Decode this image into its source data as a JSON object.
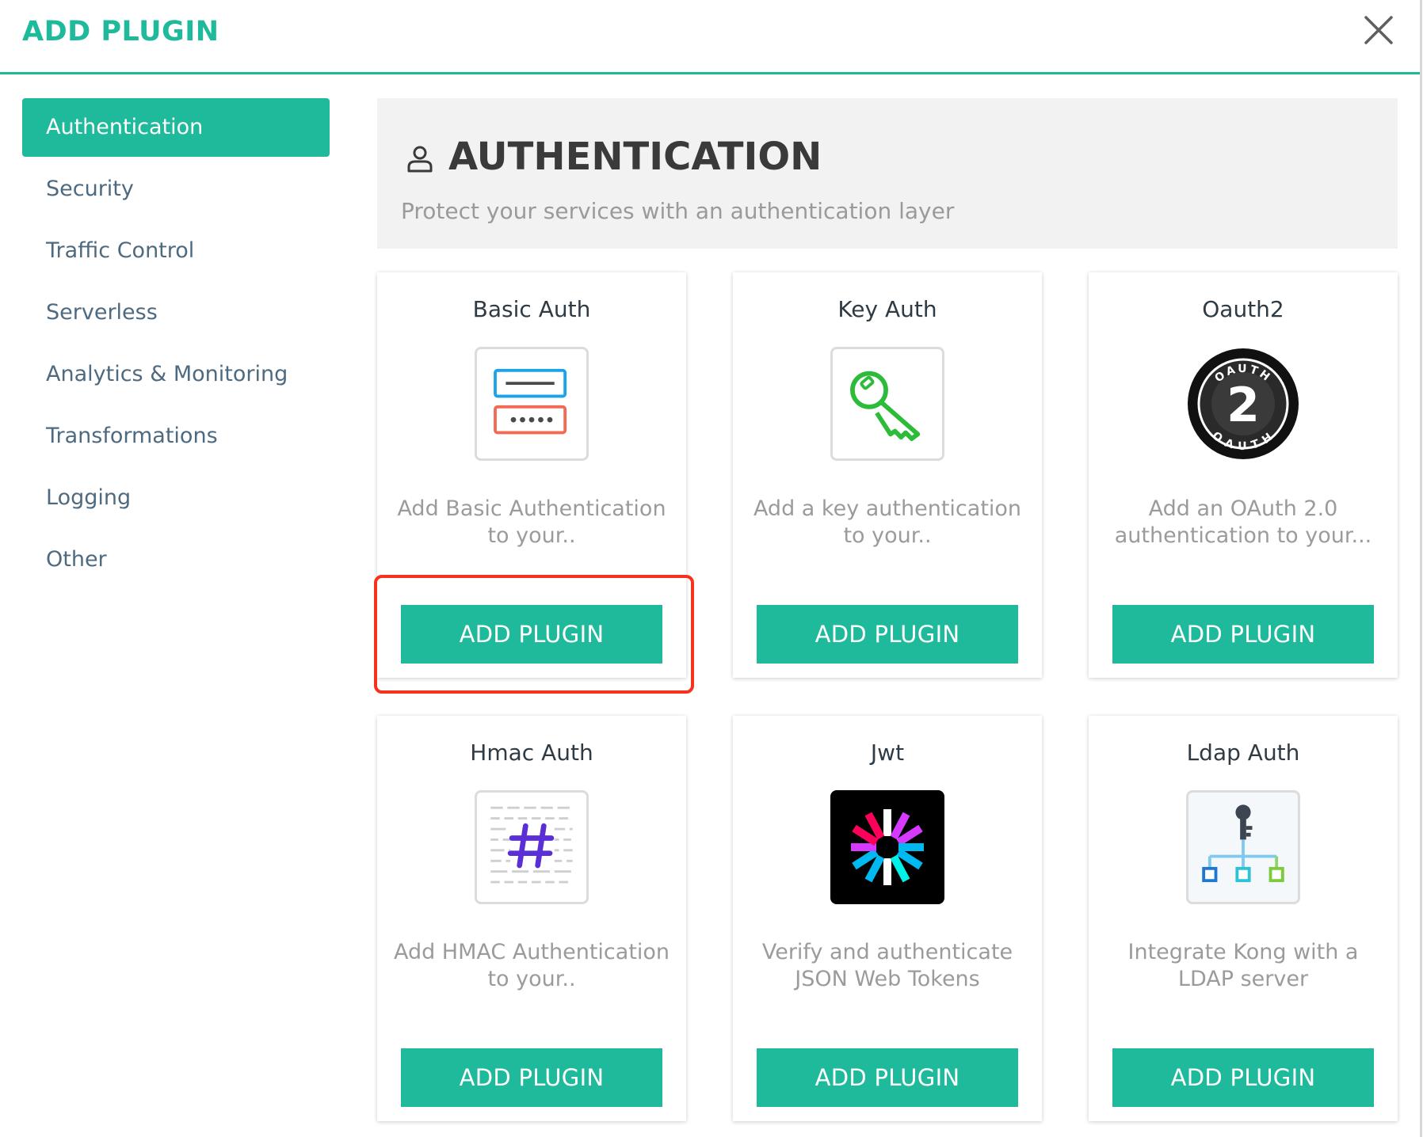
{
  "header": {
    "title": "ADD PLUGIN"
  },
  "sidebar": {
    "items": [
      {
        "label": "Authentication",
        "active": true
      },
      {
        "label": "Security"
      },
      {
        "label": "Traffic Control"
      },
      {
        "label": "Serverless"
      },
      {
        "label": "Analytics & Monitoring"
      },
      {
        "label": "Transformations"
      },
      {
        "label": "Logging"
      },
      {
        "label": "Other"
      }
    ]
  },
  "section": {
    "icon": "user-icon",
    "title": "AUTHENTICATION",
    "subtitle": "Protect your services with an authentication layer"
  },
  "plugins": [
    {
      "name": "Basic Auth",
      "description": "Add Basic Authentication to your..",
      "button": "ADD PLUGIN",
      "icon": "basic-auth-icon"
    },
    {
      "name": "Key Auth",
      "description": "Add a key authentication to your..",
      "button": "ADD PLUGIN",
      "icon": "key-icon"
    },
    {
      "name": "Oauth2",
      "description": "Add an OAuth 2.0 authentication to your...",
      "button": "ADD PLUGIN",
      "icon": "oauth2-icon",
      "badge_top": "OAUTH",
      "badge_bottom": "OAUTH",
      "badge_number": "2"
    },
    {
      "name": "Hmac Auth",
      "description": "Add HMAC Authentication to your..",
      "button": "ADD PLUGIN",
      "icon": "hash-icon"
    },
    {
      "name": "Jwt",
      "description": "Verify and authenticate JSON Web Tokens",
      "button": "ADD PLUGIN",
      "icon": "jwt-icon"
    },
    {
      "name": "Ldap Auth",
      "description": "Integrate Kong with a LDAP server",
      "button": "ADD PLUGIN",
      "icon": "ldap-icon"
    }
  ],
  "colors": {
    "accent": "#1fba9b",
    "highlight": "#f4321e",
    "sidebar_text": "#4e6a80"
  }
}
